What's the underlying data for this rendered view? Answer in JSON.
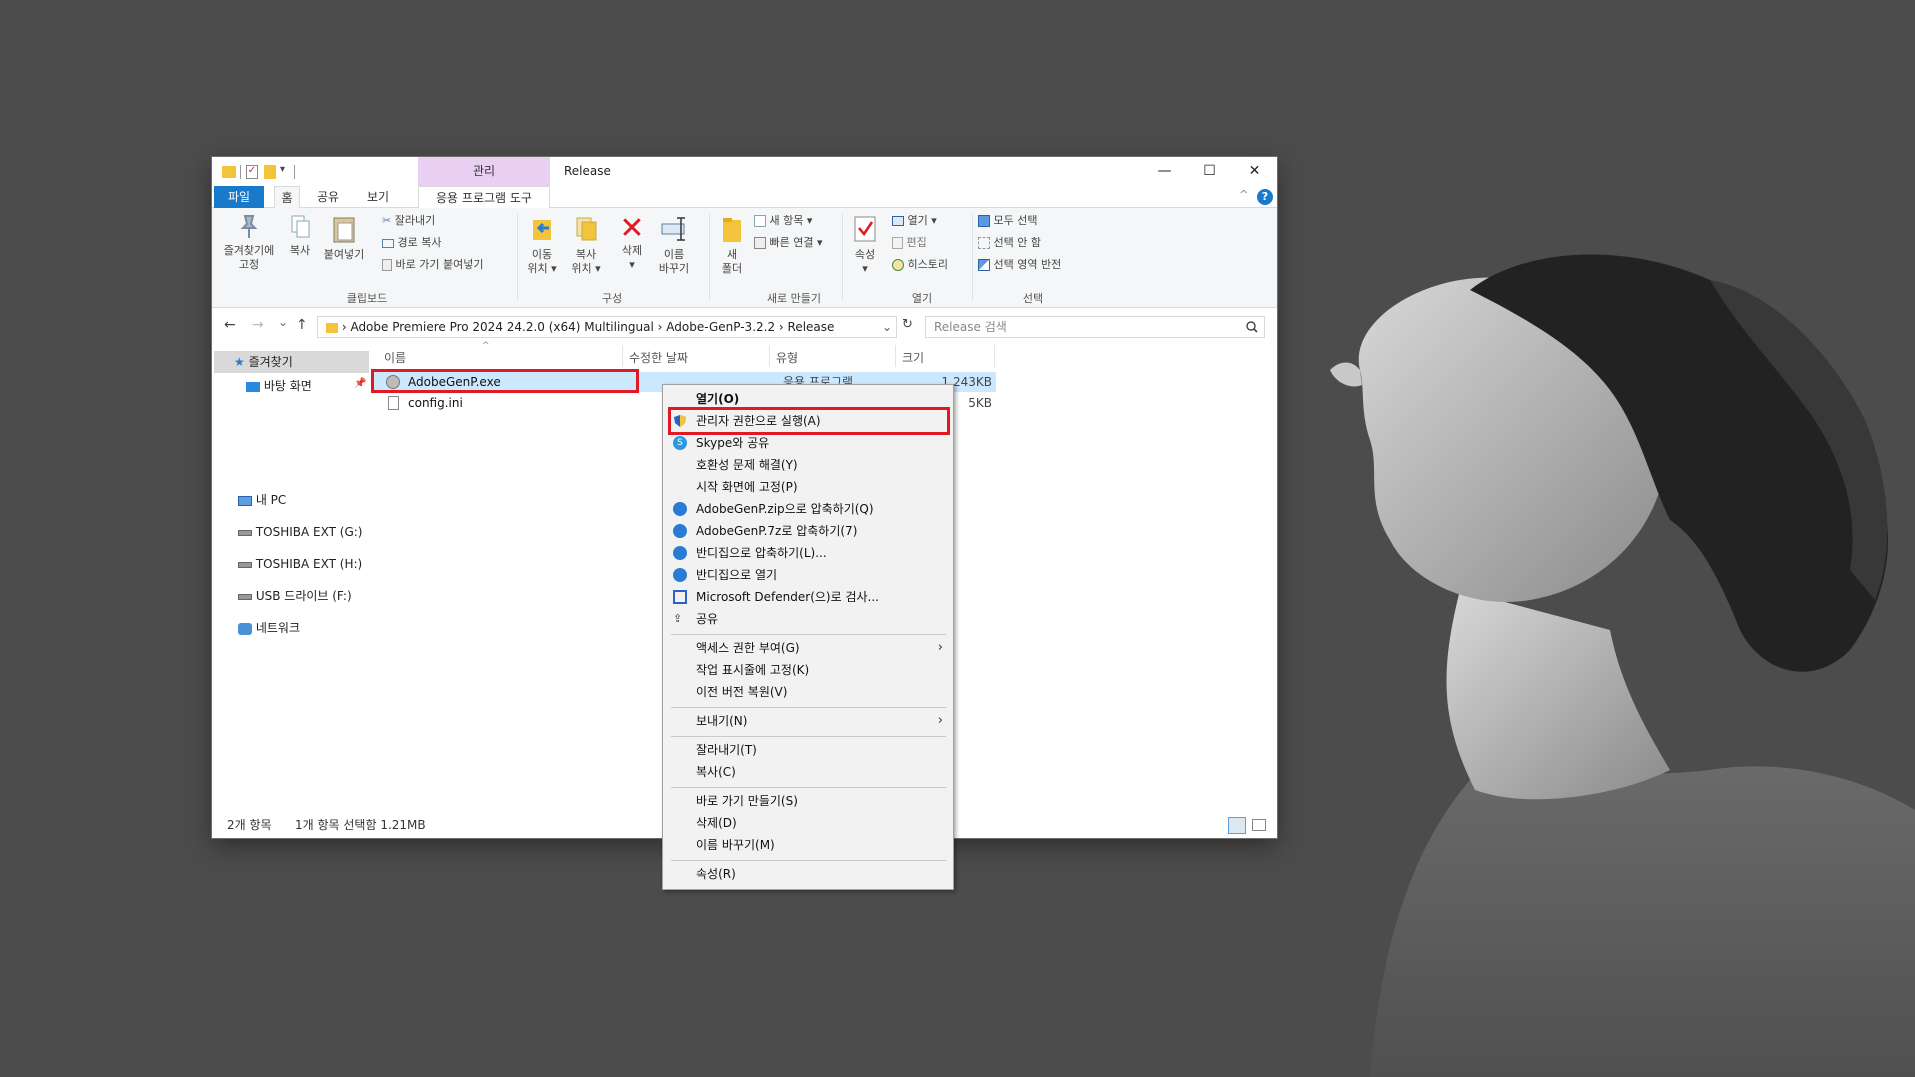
{
  "window": {
    "qat_dropdown": "▾",
    "contextual_tab_header": "관리",
    "title": "Release",
    "minimize": "—",
    "maximize": "☐",
    "close": "✕"
  },
  "tabs": [
    "파일",
    "홈",
    "공유",
    "보기",
    "응용 프로그램 도구"
  ],
  "ribbon": {
    "clipboard": {
      "pin_line1": "즐겨찾기에",
      "pin_line2": "고정",
      "copy": "복사",
      "paste": "붙여넣기",
      "cut": "잘라내기",
      "copy_path": "경로 복사",
      "paste_shortcut": "바로 가기 붙여넣기",
      "group": "클립보드"
    },
    "organize": {
      "move_line1": "이동",
      "move_line2": "위치 ▾",
      "copyto_line1": "복사",
      "copyto_line2": "위치 ▾",
      "delete": "삭제",
      "delete_arrow": "▾",
      "rename_line1": "이름",
      "rename_line2": "바꾸기",
      "group": "구성"
    },
    "new": {
      "folder_line1": "새",
      "folder_line2": "폴더",
      "new_item": "새 항목 ▾",
      "easy_access": "빠른 연결 ▾",
      "group": "새로 만들기"
    },
    "open": {
      "properties": "속성",
      "properties_arrow": "▾",
      "open": "열기 ▾",
      "edit": "편집",
      "history": "히스토리",
      "group": "열기"
    },
    "select": {
      "select_all": "모두 선택",
      "select_none": "선택 안 함",
      "invert": "선택 영역 반전",
      "group": "선택"
    }
  },
  "address": {
    "back": "←",
    "forward": "→",
    "recent": "⌄",
    "up": "↑",
    "path": "›  Adobe Premiere Pro 2024 24.2.0 (x64) Multilingual  ›  Adobe-GenP-3.2.2  ›  Release",
    "refresh": "↻",
    "search_placeholder": "Release 검색"
  },
  "nav": {
    "favorites": "즐겨찾기",
    "desktop": "바탕 화면",
    "this_pc": "내 PC",
    "drive_g": "TOSHIBA EXT (G:)",
    "drive_h": "TOSHIBA EXT (H:)",
    "drive_f": "USB 드라이브 (F:)",
    "network": "네트워크"
  },
  "columns": {
    "name": "이름",
    "date": "수정한 날짜",
    "type": "유형",
    "size": "크기"
  },
  "files": [
    {
      "name": "AdobeGenP.exe",
      "type": "응용 프로그램",
      "size": "1,243KB"
    },
    {
      "name": "config.ini",
      "size": "5KB"
    }
  ],
  "status": {
    "count": "2개 항목",
    "selection": "1개 항목 선택함 1.21MB"
  },
  "context_menu": {
    "open": "열기(O)",
    "run_as_admin": "관리자 권한으로 실행(A)",
    "skype": "Skype와 공유",
    "troubleshoot": "호환성 문제 해결(Y)",
    "pin_start": "시작 화면에 고정(P)",
    "zip": "AdobeGenP.zip으로 압축하기(Q)",
    "sevenz": "AdobeGenP.7z로 압축하기(7)",
    "bandizip_compress": "반디집으로 압축하기(L)...",
    "bandizip_open": "반디집으로 열기",
    "defender": "Microsoft Defender(으)로 검사...",
    "share": "공유",
    "give_access": "액세스 권한 부여(G)",
    "pin_taskbar": "작업 표시줄에 고정(K)",
    "restore": "이전 버전 복원(V)",
    "send_to": "보내기(N)",
    "cut": "잘라내기(T)",
    "copy": "복사(C)",
    "create_shortcut": "바로 가기 만들기(S)",
    "delete": "삭제(D)",
    "rename": "이름 바꾸기(M)",
    "properties": "속성(R)"
  },
  "colors": {
    "highlight": "#e01a22",
    "file_tab": "#1979ca",
    "context_header": "#e9d0f3",
    "selection": "#cce8ff"
  }
}
